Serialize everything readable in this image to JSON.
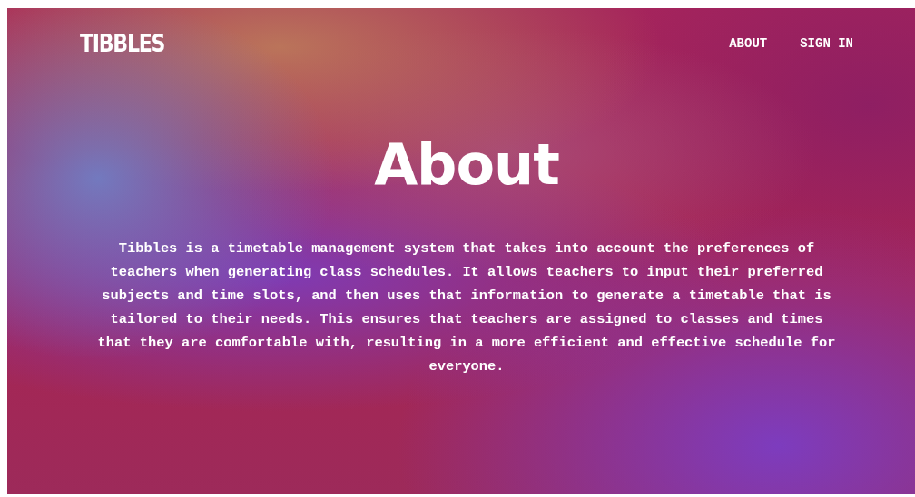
{
  "logo": "TIBBLES",
  "nav": [
    {
      "label": "ABOUT"
    },
    {
      "label": "SIGN IN"
    }
  ],
  "heading": "About",
  "description": "Tibbles is a timetable management system that takes into account the preferences of teachers when generating class schedules. It allows teachers to input their preferred subjects and time slots, and then uses that information to generate a timetable that is tailored to their needs. This ensures that teachers are assigned to classes and times that they are comfortable with, resulting in a more efficient and effective schedule for everyone."
}
